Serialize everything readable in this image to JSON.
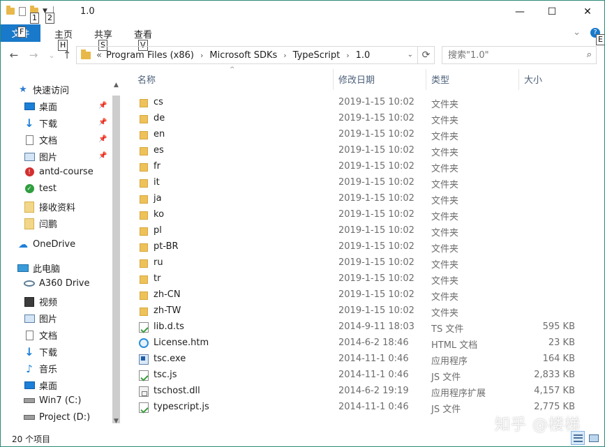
{
  "window": {
    "title": "1.0",
    "keytips": {
      "qat1": "1",
      "qat2": "2",
      "file": "F",
      "home": "H",
      "share": "S",
      "view": "V",
      "help": "E"
    },
    "controls": {
      "minimize": "—",
      "maximize": "☐",
      "close": "✕"
    }
  },
  "ribbon": {
    "file_label": "文件",
    "tabs": [
      {
        "label": "主页"
      },
      {
        "label": "共享"
      },
      {
        "label": "查看"
      }
    ],
    "expand_glyph": "⌄",
    "help_glyph": "?"
  },
  "nav": {
    "back": "←",
    "forward": "→",
    "recent": "⌄",
    "up": "↑"
  },
  "address": {
    "overflow": "«",
    "crumbs": [
      "Program Files (x86)",
      "Microsoft SDKs",
      "TypeScript",
      "1.0"
    ],
    "chevron": "›",
    "dropdown": "⌄",
    "refresh": "⟳"
  },
  "search": {
    "placeholder": "搜索\"1.0\"",
    "icon": "⌕"
  },
  "sidebar": {
    "quick_access": {
      "label": "快速访问",
      "icon": "star-icon"
    },
    "pinned": [
      {
        "label": "桌面",
        "icon": "desktop-icon",
        "pinned": true
      },
      {
        "label": "下载",
        "icon": "download-icon",
        "pinned": true
      },
      {
        "label": "文档",
        "icon": "document-icon",
        "pinned": true
      },
      {
        "label": "图片",
        "icon": "pictures-icon",
        "pinned": true
      },
      {
        "label": "antd-course",
        "icon": "error-badge-icon"
      },
      {
        "label": "test",
        "icon": "ok-badge-icon"
      },
      {
        "label": "接收资料",
        "icon": "folder-icon"
      },
      {
        "label": "闫鹏",
        "icon": "folder-icon"
      }
    ],
    "onedrive": {
      "label": "OneDrive",
      "icon": "cloud-icon"
    },
    "this_pc": {
      "label": "此电脑",
      "icon": "computer-icon"
    },
    "pc_items": [
      {
        "label": "A360 Drive",
        "icon": "a360-icon"
      },
      {
        "label": "视频",
        "icon": "video-icon"
      },
      {
        "label": "图片",
        "icon": "pictures-icon"
      },
      {
        "label": "文档",
        "icon": "document-icon"
      },
      {
        "label": "下载",
        "icon": "download-icon"
      },
      {
        "label": "音乐",
        "icon": "music-icon"
      },
      {
        "label": "桌面",
        "icon": "desktop-icon"
      },
      {
        "label": "Win7 (C:)",
        "icon": "drive-icon"
      },
      {
        "label": "Project (D:)",
        "icon": "drive-icon"
      }
    ],
    "pin_glyph": "📌",
    "scroll_up": "▲",
    "scroll_down": "▼"
  },
  "columns": {
    "name": "名称",
    "date": "修改日期",
    "type": "类型",
    "size": "大小",
    "sort_caret": "^"
  },
  "files": [
    {
      "name": "cs",
      "date": "2019-1-15 10:02",
      "type": "文件夹",
      "size": "",
      "kind": "folder"
    },
    {
      "name": "de",
      "date": "2019-1-15 10:02",
      "type": "文件夹",
      "size": "",
      "kind": "folder"
    },
    {
      "name": "en",
      "date": "2019-1-15 10:02",
      "type": "文件夹",
      "size": "",
      "kind": "folder"
    },
    {
      "name": "es",
      "date": "2019-1-15 10:02",
      "type": "文件夹",
      "size": "",
      "kind": "folder"
    },
    {
      "name": "fr",
      "date": "2019-1-15 10:02",
      "type": "文件夹",
      "size": "",
      "kind": "folder"
    },
    {
      "name": "it",
      "date": "2019-1-15 10:02",
      "type": "文件夹",
      "size": "",
      "kind": "folder"
    },
    {
      "name": "ja",
      "date": "2019-1-15 10:02",
      "type": "文件夹",
      "size": "",
      "kind": "folder"
    },
    {
      "name": "ko",
      "date": "2019-1-15 10:02",
      "type": "文件夹",
      "size": "",
      "kind": "folder"
    },
    {
      "name": "pl",
      "date": "2019-1-15 10:02",
      "type": "文件夹",
      "size": "",
      "kind": "folder"
    },
    {
      "name": "pt-BR",
      "date": "2019-1-15 10:02",
      "type": "文件夹",
      "size": "",
      "kind": "folder"
    },
    {
      "name": "ru",
      "date": "2019-1-15 10:02",
      "type": "文件夹",
      "size": "",
      "kind": "folder"
    },
    {
      "name": "tr",
      "date": "2019-1-15 10:02",
      "type": "文件夹",
      "size": "",
      "kind": "folder"
    },
    {
      "name": "zh-CN",
      "date": "2019-1-15 10:02",
      "type": "文件夹",
      "size": "",
      "kind": "folder"
    },
    {
      "name": "zh-TW",
      "date": "2019-1-15 10:02",
      "type": "文件夹",
      "size": "",
      "kind": "folder"
    },
    {
      "name": "lib.d.ts",
      "date": "2014-9-11 18:03",
      "type": "TS 文件",
      "size": "595 KB",
      "kind": "ts"
    },
    {
      "name": "License.htm",
      "date": "2014-6-2 18:46",
      "type": "HTML 文档",
      "size": "23 KB",
      "kind": "htm"
    },
    {
      "name": "tsc.exe",
      "date": "2014-11-1 0:46",
      "type": "应用程序",
      "size": "164 KB",
      "kind": "exe"
    },
    {
      "name": "tsc.js",
      "date": "2014-11-1 0:46",
      "type": "JS 文件",
      "size": "2,833 KB",
      "kind": "ts"
    },
    {
      "name": "tschost.dll",
      "date": "2014-6-2 19:19",
      "type": "应用程序扩展",
      "size": "4,157 KB",
      "kind": "dll"
    },
    {
      "name": "typescript.js",
      "date": "2014-11-1 0:46",
      "type": "JS 文件",
      "size": "2,775 KB",
      "kind": "ts"
    }
  ],
  "status": {
    "item_count": "20 个项目"
  },
  "watermark": "知乎 @楼梯",
  "colors": {
    "accent": "#1979ca",
    "folder": "#eec25a",
    "header_text": "#4c6079"
  }
}
